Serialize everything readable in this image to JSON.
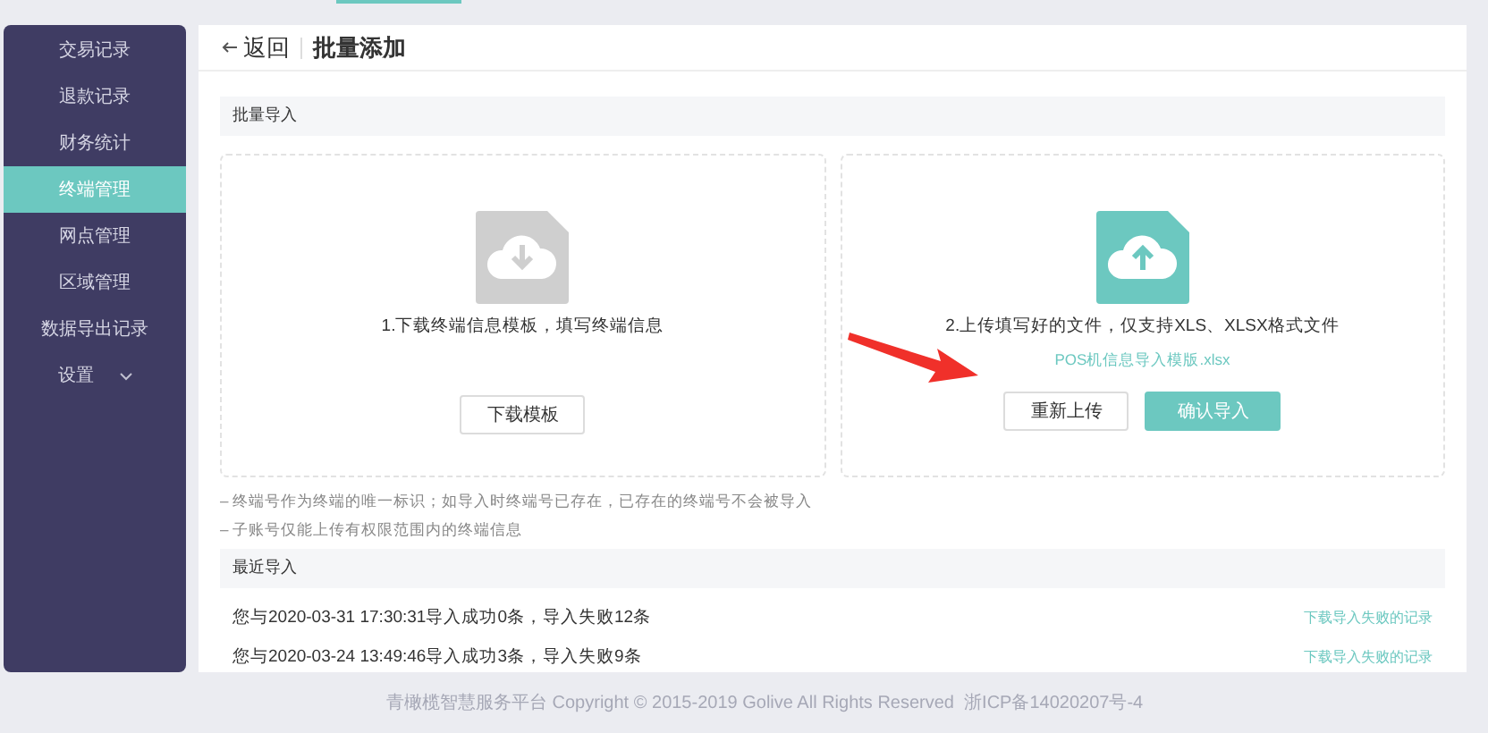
{
  "sidebar": {
    "items": [
      {
        "label": "交易记录",
        "selected": false,
        "kind": "link"
      },
      {
        "label": "退款记录",
        "selected": false,
        "kind": "link"
      },
      {
        "label": "财务统计",
        "selected": false,
        "kind": "link"
      },
      {
        "label": "终端管理",
        "selected": true,
        "kind": "link"
      },
      {
        "label": "网点管理",
        "selected": false,
        "kind": "link"
      },
      {
        "label": "区域管理",
        "selected": false,
        "kind": "link"
      },
      {
        "label": "数据导出记录",
        "selected": false,
        "kind": "link"
      },
      {
        "label": "设置",
        "selected": false,
        "kind": "group"
      }
    ]
  },
  "header": {
    "back": "返回",
    "title": "批量添加"
  },
  "import_section": {
    "title": "批量导入",
    "steps": [
      {
        "kind": "download",
        "text": "1.下载终端信息模板，填写终端信息",
        "buttons": [
          {
            "label": "下载模板",
            "primary": false
          }
        ]
      },
      {
        "kind": "upload",
        "text": "2.上传填写好的文件，仅支持XLS、XLSX格式文件",
        "file": "POS机信息导入模版.xlsx",
        "buttons": [
          {
            "label": "重新上传",
            "primary": false
          },
          {
            "label": "确认导入",
            "primary": true
          }
        ]
      }
    ],
    "notes": [
      "– 终端号作为终端的唯一标识；如导入时终端号已存在，已存在的终端号不会被导入",
      "– 子账号仅能上传有权限范围内的终端信息"
    ]
  },
  "recent_section": {
    "title": "最近导入",
    "records": [
      {
        "text": "您与2020-03-31 17:30:31导入成功0条，导入失败12条",
        "link": "下载导入失败的记录"
      },
      {
        "text": "您与2020-03-24 13:49:46导入成功3条，导入失败9条",
        "link": "下载导入失败的记录"
      }
    ]
  },
  "footer": "青橄榄智慧服务平台 Copyright © 2015-2019 Golive All Rights Reserved  浙ICP备14020207号-4"
}
